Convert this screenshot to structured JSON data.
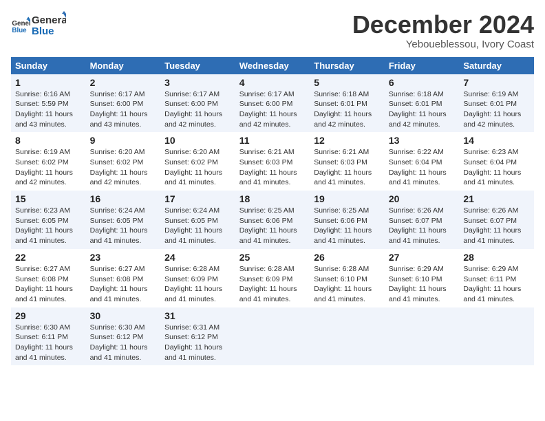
{
  "header": {
    "logo_line1": "General",
    "logo_line2": "Blue",
    "month": "December 2024",
    "location": "Yeboueblessou, Ivory Coast"
  },
  "weekdays": [
    "Sunday",
    "Monday",
    "Tuesday",
    "Wednesday",
    "Thursday",
    "Friday",
    "Saturday"
  ],
  "weeks": [
    [
      {
        "day": "1",
        "sunrise": "6:16 AM",
        "sunset": "5:59 PM",
        "daylight": "11 hours and 43 minutes."
      },
      {
        "day": "2",
        "sunrise": "6:17 AM",
        "sunset": "6:00 PM",
        "daylight": "11 hours and 43 minutes."
      },
      {
        "day": "3",
        "sunrise": "6:17 AM",
        "sunset": "6:00 PM",
        "daylight": "11 hours and 42 minutes."
      },
      {
        "day": "4",
        "sunrise": "6:17 AM",
        "sunset": "6:00 PM",
        "daylight": "11 hours and 42 minutes."
      },
      {
        "day": "5",
        "sunrise": "6:18 AM",
        "sunset": "6:01 PM",
        "daylight": "11 hours and 42 minutes."
      },
      {
        "day": "6",
        "sunrise": "6:18 AM",
        "sunset": "6:01 PM",
        "daylight": "11 hours and 42 minutes."
      },
      {
        "day": "7",
        "sunrise": "6:19 AM",
        "sunset": "6:01 PM",
        "daylight": "11 hours and 42 minutes."
      }
    ],
    [
      {
        "day": "8",
        "sunrise": "6:19 AM",
        "sunset": "6:02 PM",
        "daylight": "11 hours and 42 minutes."
      },
      {
        "day": "9",
        "sunrise": "6:20 AM",
        "sunset": "6:02 PM",
        "daylight": "11 hours and 42 minutes."
      },
      {
        "day": "10",
        "sunrise": "6:20 AM",
        "sunset": "6:02 PM",
        "daylight": "11 hours and 41 minutes."
      },
      {
        "day": "11",
        "sunrise": "6:21 AM",
        "sunset": "6:03 PM",
        "daylight": "11 hours and 41 minutes."
      },
      {
        "day": "12",
        "sunrise": "6:21 AM",
        "sunset": "6:03 PM",
        "daylight": "11 hours and 41 minutes."
      },
      {
        "day": "13",
        "sunrise": "6:22 AM",
        "sunset": "6:04 PM",
        "daylight": "11 hours and 41 minutes."
      },
      {
        "day": "14",
        "sunrise": "6:23 AM",
        "sunset": "6:04 PM",
        "daylight": "11 hours and 41 minutes."
      }
    ],
    [
      {
        "day": "15",
        "sunrise": "6:23 AM",
        "sunset": "6:05 PM",
        "daylight": "11 hours and 41 minutes."
      },
      {
        "day": "16",
        "sunrise": "6:24 AM",
        "sunset": "6:05 PM",
        "daylight": "11 hours and 41 minutes."
      },
      {
        "day": "17",
        "sunrise": "6:24 AM",
        "sunset": "6:05 PM",
        "daylight": "11 hours and 41 minutes."
      },
      {
        "day": "18",
        "sunrise": "6:25 AM",
        "sunset": "6:06 PM",
        "daylight": "11 hours and 41 minutes."
      },
      {
        "day": "19",
        "sunrise": "6:25 AM",
        "sunset": "6:06 PM",
        "daylight": "11 hours and 41 minutes."
      },
      {
        "day": "20",
        "sunrise": "6:26 AM",
        "sunset": "6:07 PM",
        "daylight": "11 hours and 41 minutes."
      },
      {
        "day": "21",
        "sunrise": "6:26 AM",
        "sunset": "6:07 PM",
        "daylight": "11 hours and 41 minutes."
      }
    ],
    [
      {
        "day": "22",
        "sunrise": "6:27 AM",
        "sunset": "6:08 PM",
        "daylight": "11 hours and 41 minutes."
      },
      {
        "day": "23",
        "sunrise": "6:27 AM",
        "sunset": "6:08 PM",
        "daylight": "11 hours and 41 minutes."
      },
      {
        "day": "24",
        "sunrise": "6:28 AM",
        "sunset": "6:09 PM",
        "daylight": "11 hours and 41 minutes."
      },
      {
        "day": "25",
        "sunrise": "6:28 AM",
        "sunset": "6:09 PM",
        "daylight": "11 hours and 41 minutes."
      },
      {
        "day": "26",
        "sunrise": "6:28 AM",
        "sunset": "6:10 PM",
        "daylight": "11 hours and 41 minutes."
      },
      {
        "day": "27",
        "sunrise": "6:29 AM",
        "sunset": "6:10 PM",
        "daylight": "11 hours and 41 minutes."
      },
      {
        "day": "28",
        "sunrise": "6:29 AM",
        "sunset": "6:11 PM",
        "daylight": "11 hours and 41 minutes."
      }
    ],
    [
      {
        "day": "29",
        "sunrise": "6:30 AM",
        "sunset": "6:11 PM",
        "daylight": "11 hours and 41 minutes."
      },
      {
        "day": "30",
        "sunrise": "6:30 AM",
        "sunset": "6:12 PM",
        "daylight": "11 hours and 41 minutes."
      },
      {
        "day": "31",
        "sunrise": "6:31 AM",
        "sunset": "6:12 PM",
        "daylight": "11 hours and 41 minutes."
      },
      null,
      null,
      null,
      null
    ]
  ],
  "labels": {
    "sunrise": "Sunrise:",
    "sunset": "Sunset:",
    "daylight": "Daylight:"
  }
}
